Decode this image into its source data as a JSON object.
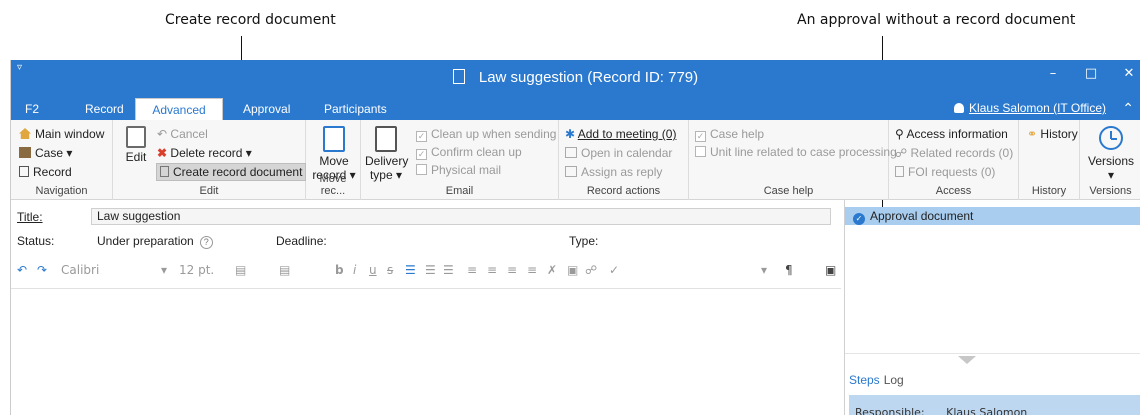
{
  "callouts": {
    "left": "Create record document",
    "right": "An approval without a record document"
  },
  "window": {
    "title": "Law suggestion (Record ID: 779)",
    "quick_access": "▿",
    "minimize": "–",
    "maximize": "□",
    "close": "✕"
  },
  "tabs": [
    "F2",
    "Record",
    "Advanced",
    "Approval",
    "Participants"
  ],
  "active_tab": "Advanced",
  "user": "Klaus Salomon (IT Office)",
  "ribbon": {
    "navigation": {
      "label": "Navigation",
      "main_window": "Main window",
      "case": "Case",
      "record": "Record"
    },
    "edit": {
      "label": "Edit",
      "edit": "Edit",
      "cancel": "Cancel",
      "delete_record": "Delete record",
      "create_record_document": "Create record document"
    },
    "move": {
      "label": "Move rec...",
      "button": "Move",
      "button2": "record"
    },
    "email": {
      "label": "Email",
      "delivery": "Delivery",
      "delivery2": "type",
      "clean_up": "Clean up when sending",
      "confirm_clean": "Confirm clean up",
      "physical_mail": "Physical mail"
    },
    "record_actions": {
      "label": "Record actions",
      "add_meeting": "Add to meeting (0)",
      "open_calendar": "Open in calendar",
      "assign_reply": "Assign as reply"
    },
    "case_help": {
      "label": "Case help",
      "case_help": "Case help",
      "unit_line": "Unit line related to case processing"
    },
    "access": {
      "label": "Access",
      "access_info": "Access information",
      "related_records": "Related records (0)",
      "foi_requests": "FOI requests (0)"
    },
    "history": {
      "label": "History",
      "history": "History"
    },
    "versions": {
      "label": "Versions",
      "versions": "Versions"
    }
  },
  "form": {
    "title_label": "Title:",
    "title_value": "Law suggestion",
    "status_label": "Status:",
    "status_value": "Under preparation",
    "deadline_label": "Deadline:",
    "type_label": "Type:"
  },
  "format_bar": {
    "font": "Calibri",
    "size": "12 pt."
  },
  "right_panel": {
    "approval_item": "Approval document",
    "steps_tab": "Steps",
    "log_tab": "Log",
    "responsible_label": "Responsible:",
    "responsible_value": "Klaus Salomon"
  },
  "colors": {
    "accent": "#2a79cf",
    "selection": "#a9cdef"
  }
}
